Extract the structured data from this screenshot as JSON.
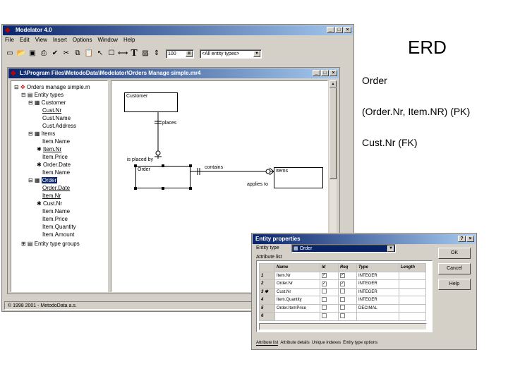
{
  "slide": {
    "title": "ERD",
    "lines": [
      "Order",
      "(Order.Nr, Item.NR) (PK)",
      "Cust.Nr (FK)"
    ]
  },
  "app": {
    "title": "Modelator 4.0",
    "menu": [
      "File",
      "Edit",
      "View",
      "Insert",
      "Options",
      "Window",
      "Help"
    ],
    "zoom": "100",
    "entity_filter": "<All entity types>",
    "status": "1998 2001 - MetodoData a.s."
  },
  "doc": {
    "title": "L:\\Program Files\\MetodoData\\Modelator\\Orders Manage simple.mr4",
    "tree": [
      "Orders manage simple.m",
      "Entity types",
      "Customer",
      "Cust.Nr",
      "Cust.Name",
      "Cust.Address",
      "Items",
      "Item.Name",
      "Item.Nr",
      "Item.Price",
      "Order.Date",
      "Item.Name",
      "Order",
      "Order.Date",
      "Item.Nr",
      "Cust.Nr",
      "Item.Name",
      "Item.Price",
      "Item.Quantity",
      "Item.Amount",
      "Entity type groups"
    ],
    "diagram": {
      "customer": "Customer",
      "order": "Order",
      "items": "Items",
      "places": "places",
      "is_placed_by": "is placed by",
      "contains": "contains",
      "applies_to": "applies to"
    }
  },
  "dialog": {
    "title": "Entity properties",
    "entity_label": "Entity type",
    "entity_value": "Order",
    "attr_list_label": "Attribute list",
    "buttons": {
      "ok": "OK",
      "cancel": "Cancel",
      "help": "Help"
    },
    "columns": [
      "Name",
      "Id",
      "Req",
      "Type",
      "Length"
    ],
    "rows": [
      {
        "n": "1",
        "name": "Item.Nr",
        "id": true,
        "req": true,
        "type": "INTEGER",
        "length": ""
      },
      {
        "n": "2",
        "name": "Order.Nr",
        "id": true,
        "req": true,
        "type": "INTEGER",
        "length": ""
      },
      {
        "n": "3",
        "name": "Cust.Nr",
        "id": false,
        "req": false,
        "type": "INTEGER",
        "length": ""
      },
      {
        "n": "4",
        "name": "Item.Quantity",
        "id": false,
        "req": false,
        "type": "INTEGER",
        "length": ""
      },
      {
        "n": "5",
        "name": "Order.ItemPrice",
        "id": false,
        "req": false,
        "type": "DECIMAL",
        "length": ""
      },
      {
        "n": "6",
        "name": "",
        "id": false,
        "req": false,
        "type": "",
        "length": ""
      }
    ],
    "tabs": [
      "Attribute list",
      "Attribute details",
      "Unique indexes",
      "Entity type options"
    ]
  }
}
